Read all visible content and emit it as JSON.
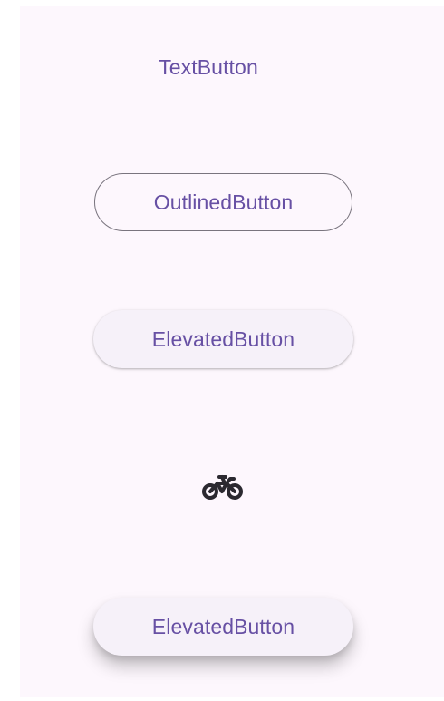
{
  "buttons": {
    "text_button_label": "TextButton",
    "outlined_button_label": "OutlinedButton",
    "elevated_button_label": "ElevatedButton",
    "elevated_button_2_label": "ElevatedButton"
  },
  "icon": {
    "name": "bicycle-icon"
  },
  "colors": {
    "primary": "#6750a4",
    "surface": "#fdf7fd",
    "outline": "#79747e",
    "elevated_surface": "#f6f1f9",
    "icon": "#1c1b1f"
  }
}
